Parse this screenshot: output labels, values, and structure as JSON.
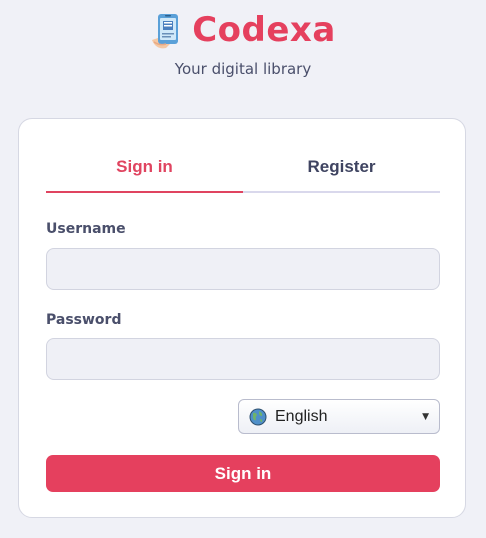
{
  "brand": {
    "title": "Codexa",
    "tagline": "Your digital library",
    "logo_icon": "book-phone-icon",
    "accent_color": "#e5405e"
  },
  "tabs": [
    {
      "label": "Sign in",
      "active": true
    },
    {
      "label": "Register",
      "active": false
    }
  ],
  "form": {
    "username_label": "Username",
    "username_value": "",
    "password_label": "Password",
    "password_value": ""
  },
  "language": {
    "icon": "globe-icon",
    "selected": "English"
  },
  "submit_label": "Sign in"
}
